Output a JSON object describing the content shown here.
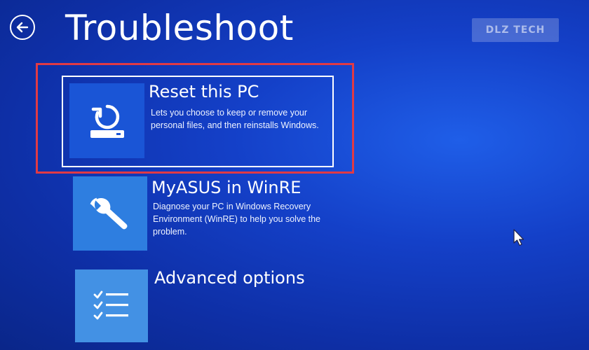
{
  "header": {
    "title": "Troubleshoot",
    "back_icon": "back-arrow-icon"
  },
  "watermark": {
    "text": "DLZ TECH"
  },
  "options": [
    {
      "title": "Reset this PC",
      "description": "Lets you choose to keep or remove your personal files, and then reinstalls Windows.",
      "icon": "reset-drive-icon",
      "selected": true
    },
    {
      "title": "MyASUS in WinRE",
      "description": "Diagnose your PC in Windows Recovery Environment (WinRE) to help you solve the problem.",
      "icon": "wrench-icon",
      "selected": false
    },
    {
      "title": "Advanced options",
      "description": "",
      "icon": "checklist-icon",
      "selected": false
    }
  ],
  "colors": {
    "background": "#1440c8",
    "tile_selected": "#1a55d6",
    "tile": "#2e7ee0",
    "highlight": "#e03a45"
  }
}
